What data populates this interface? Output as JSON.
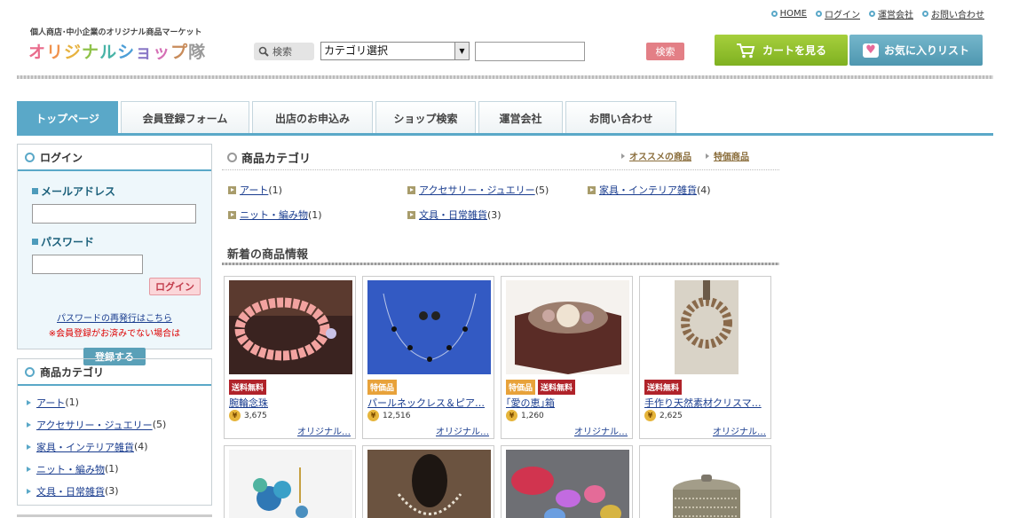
{
  "header": {
    "top_links": [
      "HOME",
      "ログイン",
      "運営会社",
      "お問い合わせ"
    ],
    "tagline": "個人商店･中小企業のオリジナル商品マーケット",
    "logo_chars": [
      "オ",
      "リ",
      "ジ",
      "ナ",
      "ル",
      "シ",
      "ョ",
      "ッ",
      "プ",
      "隊"
    ],
    "search_label": "検索",
    "category_select": "カテゴリ選択",
    "search_input_value": "",
    "search_button": "検索",
    "cart_button": "カートを見る",
    "favorites_button": "お気に入りリスト"
  },
  "tabs": [
    {
      "label": "トップページ",
      "active": true
    },
    {
      "label": "会員登録フォーム",
      "active": false
    },
    {
      "label": "出店のお申込み",
      "active": false
    },
    {
      "label": "ショップ検索",
      "active": false
    },
    {
      "label": "運営会社",
      "active": false
    },
    {
      "label": "お問い合わせ",
      "active": false
    }
  ],
  "sidebar": {
    "login": {
      "title": "ログイン",
      "email_label": "メールアドレス",
      "password_label": "パスワード",
      "login_button": "ログイン",
      "reissue_link": "パスワードの再発行はこちら",
      "notice": "※会員登録がお済みでない場合は",
      "register_button": "登録する"
    },
    "categories": {
      "title": "商品カテゴリ",
      "items": [
        {
          "name": "アート",
          "count": "(1)"
        },
        {
          "name": "アクセサリー・ジュエリー",
          "count": "(5)"
        },
        {
          "name": "家具・インテリア雑貨",
          "count": "(4)"
        },
        {
          "name": "ニット・編み物",
          "count": "(1)"
        },
        {
          "name": "文具・日常雑貨",
          "count": "(3)"
        }
      ]
    }
  },
  "main": {
    "category_title": "商品カテゴリ",
    "category_links": [
      "オススメの商品",
      "特価商品"
    ],
    "categories": [
      {
        "name": "アート",
        "count": "(1)"
      },
      {
        "name": "アクセサリー・ジュエリー",
        "count": "(5)"
      },
      {
        "name": "家具・インテリア雑貨",
        "count": "(4)"
      },
      {
        "name": "ニット・編み物",
        "count": "(1)"
      },
      {
        "name": "文具・日常雑貨",
        "count": "(3)"
      }
    ],
    "new_title": "新着の商品情報",
    "products": [
      {
        "name": "腕輪念珠",
        "price": "3,675",
        "shop": "オリジナル…",
        "badges": [
          "送料無料"
        ]
      },
      {
        "name": "パールネックレス＆ピア…",
        "price": "12,516",
        "shop": "オリジナル…",
        "badges": [
          "特価品"
        ]
      },
      {
        "name": "｢愛の恵｣箱",
        "price": "1,260",
        "shop": "オリジナル…",
        "badges": [
          "特価品",
          "送料無料"
        ]
      },
      {
        "name": "手作り天然素材クリスマ…",
        "price": "2,625",
        "shop": "オリジナル…",
        "badges": [
          "送料無料"
        ]
      }
    ],
    "colors": {
      "accent": "#5aa8c8",
      "free_badge": "#b0232a",
      "sale_badge": "#e8a23a"
    }
  }
}
